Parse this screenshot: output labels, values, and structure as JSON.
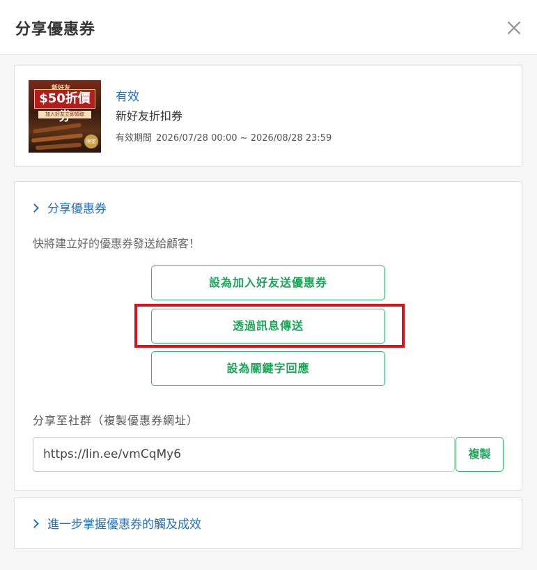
{
  "header": {
    "title": "分享優惠券"
  },
  "coupon": {
    "image_badge": "新好友",
    "image_amount": "$50折價券",
    "image_tagline": "加入好友立即領取",
    "image_limit": "限定",
    "status": "有效",
    "name": "新好友折扣券",
    "validity_label": "有效期間",
    "validity_range": "2026/07/28 00:00 ~ 2026/08/28 23:59"
  },
  "share": {
    "toggle_label": "分享優惠券",
    "description": "快將建立好的優惠券發送給顧客！",
    "buttons": [
      {
        "label": "設為加入好友送優惠券"
      },
      {
        "label": "透過訊息傳送"
      },
      {
        "label": "設為關鍵字回應"
      }
    ],
    "social_label": "分享至社群（複製優惠券網址）",
    "url_value": "https://lin.ee/vmCqMy6",
    "copy_label": "複製"
  },
  "more": {
    "toggle_label": "進一步掌握優惠券的觸及成效"
  },
  "colors": {
    "accent_green": "#2dbb66",
    "link_blue": "#1f6fc8",
    "highlight_red": "#e0101a"
  }
}
